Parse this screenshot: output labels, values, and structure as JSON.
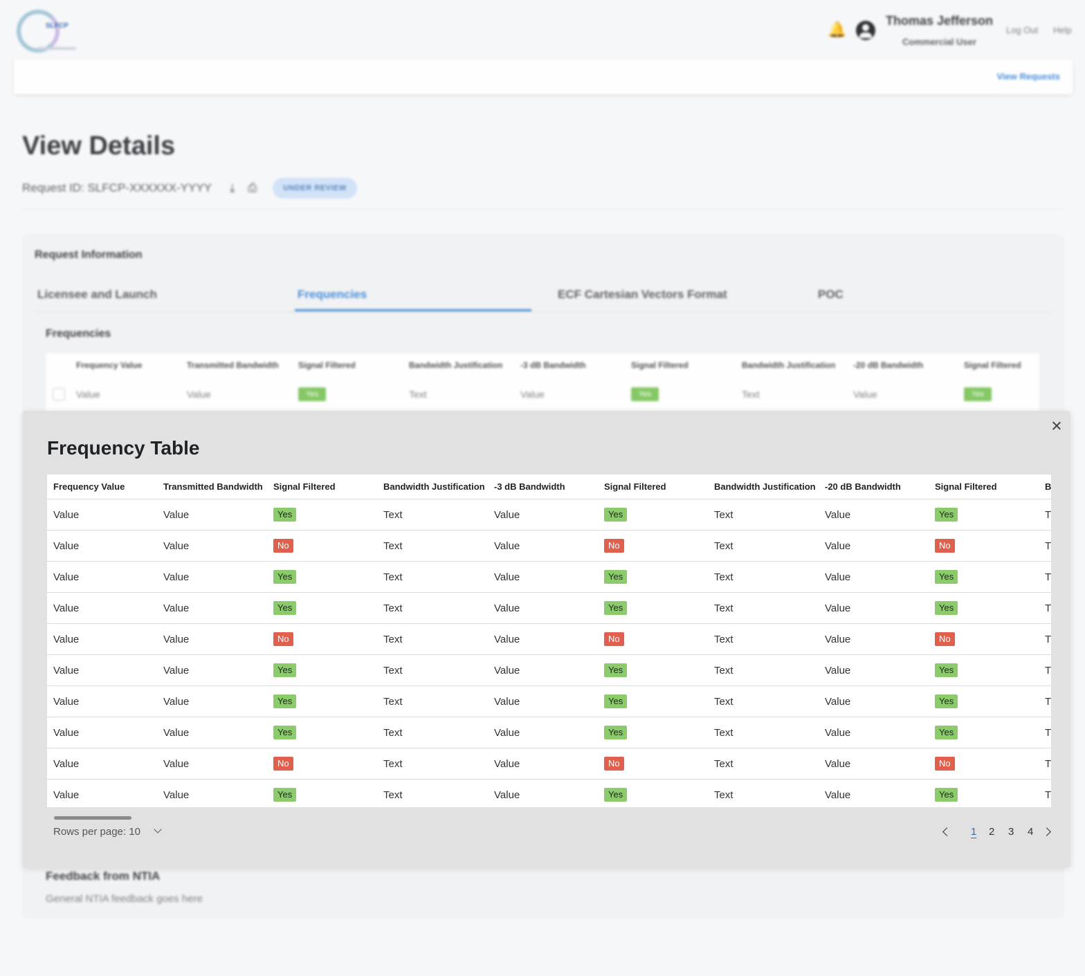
{
  "header": {
    "logo_text": "SLFCP",
    "user_name": "Thomas Jefferson",
    "user_role": "Commercial User",
    "logout_label": "Log Out",
    "help_label": "Help",
    "view_requests_label": "View Requests",
    "icons": [
      "notification-bell-icon",
      "user-avatar-icon",
      "download-icon",
      "print-icon"
    ]
  },
  "page": {
    "title": "View Details",
    "request_id": "Request ID: SLFCP-XXXXXX-YYYY",
    "status_badge": "UNDER REVIEW"
  },
  "request_info": {
    "title": "Request Information",
    "tabs": [
      {
        "label": "Licensee and Launch",
        "active": false
      },
      {
        "label": "Frequencies",
        "active": true
      },
      {
        "label": "ECF Cartesian Vectors Format",
        "active": false
      },
      {
        "label": "POC",
        "active": false
      }
    ],
    "section_title": "Frequencies",
    "mini_table": {
      "headers": [
        "Frequency Value",
        "Transmitted Bandwidth",
        "Signal Filtered",
        "Bandwidth Justification",
        "-3 dB Bandwidth",
        "Signal Filtered",
        "Bandwidth Justification",
        "-20 dB Bandwidth",
        "Signal Filtered"
      ],
      "row": [
        "Value",
        "Value",
        "Yes",
        "Text",
        "Value",
        "Yes",
        "Text",
        "Value",
        "Yes"
      ]
    },
    "feedback_title": "Feedback from NTIA",
    "feedback_text": "General NTIA feedback goes here"
  },
  "modal": {
    "title": "Frequency Table",
    "close_icon": "close-icon",
    "columns": [
      "Frequency Value",
      "Transmitted Bandwidth",
      "Signal Filtered",
      "Bandwidth Justification",
      "-3 dB Bandwidth",
      "Signal Filtered",
      "Bandwidth Justification",
      "-20 dB Bandwidth",
      "Signal Filtered",
      "B"
    ],
    "rows": [
      [
        "Value",
        "Value",
        "Yes",
        "Text",
        "Value",
        "Yes",
        "Text",
        "Value",
        "Yes",
        "T"
      ],
      [
        "Value",
        "Value",
        "No",
        "Text",
        "Value",
        "No",
        "Text",
        "Value",
        "No",
        "T"
      ],
      [
        "Value",
        "Value",
        "Yes",
        "Text",
        "Value",
        "Yes",
        "Text",
        "Value",
        "Yes",
        "T"
      ],
      [
        "Value",
        "Value",
        "Yes",
        "Text",
        "Value",
        "Yes",
        "Text",
        "Value",
        "Yes",
        "T"
      ],
      [
        "Value",
        "Value",
        "No",
        "Text",
        "Value",
        "No",
        "Text",
        "Value",
        "No",
        "T"
      ],
      [
        "Value",
        "Value",
        "Yes",
        "Text",
        "Value",
        "Yes",
        "Text",
        "Value",
        "Yes",
        "T"
      ],
      [
        "Value",
        "Value",
        "Yes",
        "Text",
        "Value",
        "Yes",
        "Text",
        "Value",
        "Yes",
        "T"
      ],
      [
        "Value",
        "Value",
        "Yes",
        "Text",
        "Value",
        "Yes",
        "Text",
        "Value",
        "Yes",
        "T"
      ],
      [
        "Value",
        "Value",
        "No",
        "Text",
        "Value",
        "No",
        "Text",
        "Value",
        "No",
        "T"
      ],
      [
        "Value",
        "Value",
        "Yes",
        "Text",
        "Value",
        "Yes",
        "Text",
        "Value",
        "Yes",
        "T"
      ]
    ],
    "rows_per_page_label": "Rows per page: 10",
    "pagination": {
      "pages": [
        "1",
        "2",
        "3",
        "4"
      ],
      "current": "1"
    },
    "colors": {
      "yes": "#8bcb6b",
      "no": "#e0604d",
      "link": "#2f6fb7"
    }
  }
}
